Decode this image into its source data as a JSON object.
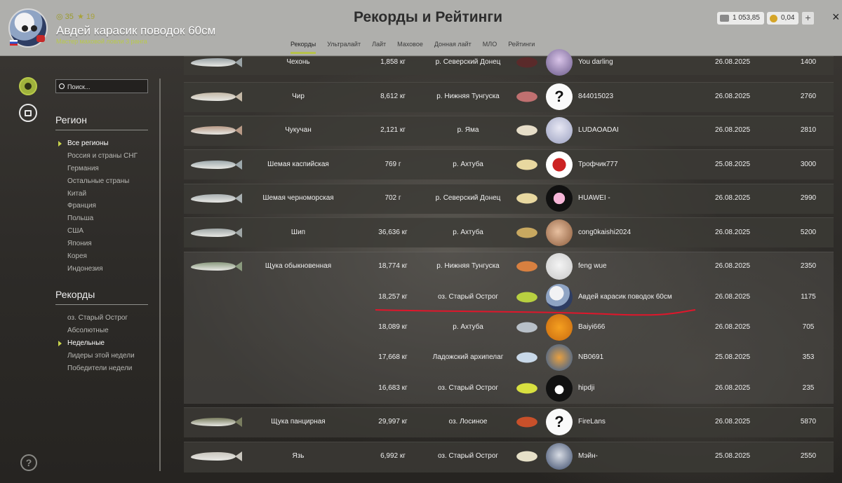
{
  "header": {
    "title": "Рекорды и Рейтинги",
    "profile": {
      "coins": "35",
      "stars": "19",
      "name": "Авдей карасик поводок 60см",
      "rank": "Мастер маховой ловли 3 ранга"
    },
    "tabs": [
      "Рекорды",
      "Ультралайт",
      "Лайт",
      "Маховое",
      "Донная лайт",
      "МЛО",
      "Рейтинги"
    ],
    "active_tab": "Рекорды",
    "silver": "1 053,85",
    "gold": "0,04",
    "plus": "+",
    "close": "×"
  },
  "sidebar": {
    "search_placeholder": "Поиск...",
    "region_heading": "Регион",
    "regions": [
      "Все регионы",
      "Россия и страны СНГ",
      "Германия",
      "Остальные страны",
      "Китай",
      "Франция",
      "Польша",
      "США",
      "Япония",
      "Корея",
      "Индонезия"
    ],
    "active_region": "Все регионы",
    "records_heading": "Рекорды",
    "records": [
      "оз. Старый Острог",
      "Абсолютные",
      "Недельные",
      "Лидеры этой недели",
      "Победители недели"
    ],
    "active_record": "Недельные",
    "help": "?"
  },
  "rows": [
    {
      "fish": "Чехонь",
      "weight": "1,858 кг",
      "location": "р. Северский Донец",
      "player": "You darling",
      "date": "26.08.2025",
      "score": "1400"
    },
    {
      "fish": "Чир",
      "weight": "8,612 кг",
      "location": "р. Нижняя Тунгуска",
      "player": "844015023",
      "date": "26.08.2025",
      "score": "2760"
    },
    {
      "fish": "Чукучан",
      "weight": "2,121 кг",
      "location": "р. Яма",
      "player": "LUDAOADAI",
      "date": "26.08.2025",
      "score": "2810"
    },
    {
      "fish": "Шемая каспийская",
      "weight": "769 г",
      "location": "р. Ахтуба",
      "player": "Трофчик777",
      "date": "25.08.2025",
      "score": "3000"
    },
    {
      "fish": "Шемая черноморская",
      "weight": "702 г",
      "location": "р. Северский Донец",
      "player": "HUAWEI -",
      "date": "26.08.2025",
      "score": "2990"
    },
    {
      "fish": "Шип",
      "weight": "36,636 кг",
      "location": "р. Ахтуба",
      "player": "cong0kaishi2024",
      "date": "26.08.2025",
      "score": "5200"
    },
    {
      "fish": "Щука обыкновенная",
      "weight": "18,774 кг",
      "location": "р. Нижняя Тунгуска",
      "player": "feng wue",
      "date": "26.08.2025",
      "score": "2350"
    },
    {
      "fish": "",
      "weight": "18,257 кг",
      "location": "оз. Старый Острог",
      "player": "Авдей карасик поводок 60см",
      "date": "26.08.2025",
      "score": "1175"
    },
    {
      "fish": "",
      "weight": "18,089 кг",
      "location": "р. Ахтуба",
      "player": "Baiyi666",
      "date": "26.08.2025",
      "score": "705"
    },
    {
      "fish": "",
      "weight": "17,668 кг",
      "location": "Ладожский архипелаг",
      "player": "NB0691",
      "date": "25.08.2025",
      "score": "353"
    },
    {
      "fish": "",
      "weight": "16,683 кг",
      "location": "оз. Старый Острог",
      "player": "hipdji",
      "date": "26.08.2025",
      "score": "235"
    },
    {
      "fish": "Щука панцирная",
      "weight": "29,997 кг",
      "location": "оз. Лосиное",
      "player": "FireLans",
      "date": "26.08.2025",
      "score": "5870"
    },
    {
      "fish": "Язь",
      "weight": "6,992 кг",
      "location": "оз. Старый Острог",
      "player": "Мэйн-",
      "date": "25.08.2025",
      "score": "2550"
    }
  ],
  "avatar_marks": {
    "unknown": "?"
  }
}
